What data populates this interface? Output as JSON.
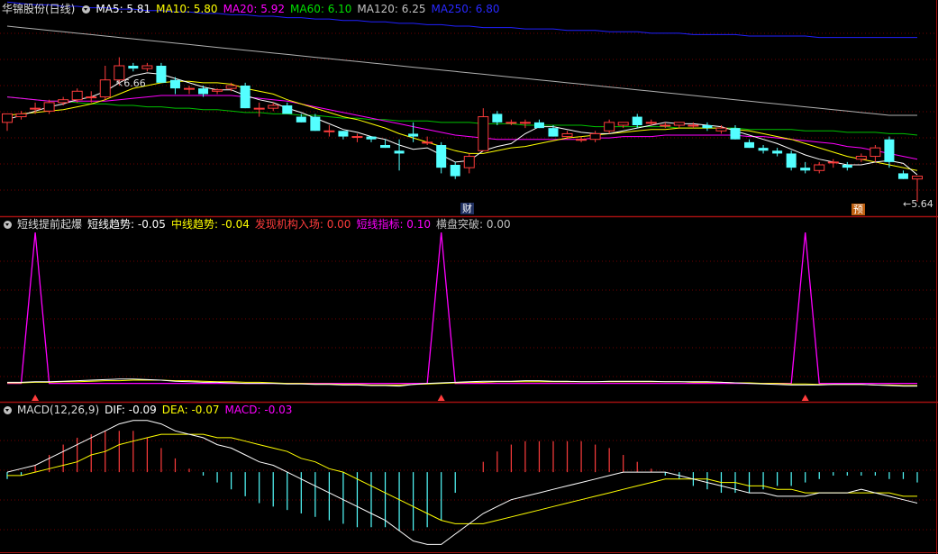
{
  "colors": {
    "up": "#ff3c3c",
    "down": "#54ffff",
    "white": "#ffffff",
    "yellow": "#ffff00",
    "magenta": "#ff00ff",
    "green": "#00c000",
    "grey": "#b0b0b0",
    "blue": "#2020ff",
    "divider": "#a01010",
    "grid": "#700000"
  },
  "panels": {
    "kline": {
      "title": "华锦股份(日线)",
      "ma": [
        {
          "name": "MA5",
          "value": "5.81",
          "color": "#ffffff"
        },
        {
          "name": "MA10",
          "value": "5.80",
          "color": "#ffff00"
        },
        {
          "name": "MA20",
          "value": "5.92",
          "color": "#ff00ff"
        },
        {
          "name": "MA60",
          "value": "6.10",
          "color": "#00e000"
        },
        {
          "name": "MA120",
          "value": "6.25",
          "color": "#c0c0c0"
        },
        {
          "name": "MA250",
          "value": "6.80",
          "color": "#2828ff"
        }
      ],
      "high_label": "6.66",
      "low_label": "5.64",
      "badge_cai": "财",
      "badge_yu": "预"
    },
    "indicator": {
      "title": "短线提前起爆",
      "items": [
        {
          "name": "短线趋势",
          "value": "-0.05",
          "color": "#ffffff"
        },
        {
          "name": "中线趋势",
          "value": "-0.04",
          "color": "#ffff00"
        },
        {
          "name": "发现机构入场",
          "value": "0.00",
          "color": "#ff3c3c"
        },
        {
          "name": "短线指标",
          "value": "0.10",
          "color": "#ff00ff"
        },
        {
          "name": "横盘突破",
          "value": "0.00",
          "color": "#c0c0c0"
        }
      ]
    },
    "macd": {
      "title": "MACD(12,26,9)",
      "items": [
        {
          "name": "DIF",
          "value": "-0.09",
          "color": "#ffffff"
        },
        {
          "name": "DEA",
          "value": "-0.07",
          "color": "#ffff00"
        },
        {
          "name": "MACD",
          "value": "-0.03",
          "color": "#ff00ff"
        }
      ]
    }
  },
  "chart_data": [
    {
      "type": "candlestick",
      "title": "华锦股份(日线)",
      "ylim": [
        5.55,
        6.95
      ],
      "candles": [
        [
          6.2,
          6.26,
          6.14,
          6.26
        ],
        [
          6.24,
          6.28,
          6.22,
          6.26
        ],
        [
          6.3,
          6.34,
          6.26,
          6.3
        ],
        [
          6.28,
          6.36,
          6.26,
          6.34
        ],
        [
          6.34,
          6.38,
          6.32,
          6.36
        ],
        [
          6.36,
          6.44,
          6.34,
          6.42
        ],
        [
          6.38,
          6.42,
          6.34,
          6.38
        ],
        [
          6.38,
          6.6,
          6.36,
          6.5
        ],
        [
          6.5,
          6.66,
          6.46,
          6.6
        ],
        [
          6.6,
          6.62,
          6.56,
          6.58
        ],
        [
          6.58,
          6.62,
          6.56,
          6.6
        ],
        [
          6.6,
          6.62,
          6.48,
          6.48
        ],
        [
          6.5,
          6.52,
          6.4,
          6.44
        ],
        [
          6.44,
          6.46,
          6.4,
          6.44
        ],
        [
          6.44,
          6.46,
          6.38,
          6.4
        ],
        [
          6.42,
          6.44,
          6.4,
          6.43
        ],
        [
          6.44,
          6.48,
          6.42,
          6.46
        ],
        [
          6.46,
          6.48,
          6.3,
          6.3
        ],
        [
          6.3,
          6.34,
          6.24,
          6.3
        ],
        [
          6.3,
          6.34,
          6.28,
          6.32
        ],
        [
          6.32,
          6.34,
          6.26,
          6.26
        ],
        [
          6.24,
          6.26,
          6.2,
          6.2
        ],
        [
          6.24,
          6.26,
          6.14,
          6.14
        ],
        [
          6.14,
          6.18,
          6.1,
          6.14
        ],
        [
          6.14,
          6.14,
          6.08,
          6.1
        ],
        [
          6.1,
          6.12,
          6.06,
          6.1
        ],
        [
          6.1,
          6.1,
          6.06,
          6.08
        ],
        [
          6.04,
          6.08,
          6.02,
          6.02
        ],
        [
          6.0,
          6.08,
          5.86,
          5.98
        ],
        [
          6.12,
          6.2,
          6.06,
          6.1
        ],
        [
          6.06,
          6.1,
          6.04,
          6.06
        ],
        [
          6.04,
          6.06,
          5.84,
          5.88
        ],
        [
          5.9,
          5.92,
          5.8,
          5.82
        ],
        [
          5.88,
          5.98,
          5.84,
          5.96
        ],
        [
          6.0,
          6.3,
          6.0,
          6.24
        ],
        [
          6.26,
          6.28,
          6.18,
          6.2
        ],
        [
          6.2,
          6.22,
          6.18,
          6.2
        ],
        [
          6.2,
          6.22,
          6.16,
          6.2
        ],
        [
          6.2,
          6.22,
          6.16,
          6.16
        ],
        [
          6.16,
          6.18,
          6.1,
          6.1
        ],
        [
          6.1,
          6.14,
          6.08,
          6.12
        ],
        [
          6.08,
          6.1,
          6.06,
          6.08
        ],
        [
          6.08,
          6.14,
          6.06,
          6.12
        ],
        [
          6.14,
          6.22,
          6.12,
          6.2
        ],
        [
          6.18,
          6.2,
          6.16,
          6.2
        ],
        [
          6.24,
          6.26,
          6.16,
          6.18
        ],
        [
          6.2,
          6.22,
          6.18,
          6.2
        ],
        [
          6.18,
          6.2,
          6.16,
          6.18
        ],
        [
          6.18,
          6.2,
          6.16,
          6.2
        ],
        [
          6.18,
          6.2,
          6.16,
          6.18
        ],
        [
          6.18,
          6.2,
          6.14,
          6.16
        ],
        [
          6.14,
          6.18,
          6.12,
          6.16
        ],
        [
          6.16,
          6.18,
          6.08,
          6.08
        ],
        [
          6.06,
          6.08,
          6.02,
          6.02
        ],
        [
          6.02,
          6.04,
          5.98,
          6.0
        ],
        [
          6.0,
          6.02,
          5.96,
          5.98
        ],
        [
          5.98,
          6.0,
          5.86,
          5.88
        ],
        [
          5.88,
          5.92,
          5.84,
          5.86
        ],
        [
          5.86,
          5.92,
          5.84,
          5.9
        ],
        [
          5.92,
          5.94,
          5.88,
          5.92
        ],
        [
          5.9,
          5.92,
          5.86,
          5.88
        ],
        [
          5.94,
          5.98,
          5.92,
          5.96
        ],
        [
          5.96,
          6.04,
          5.92,
          6.02
        ],
        [
          6.08,
          6.1,
          5.88,
          5.92
        ],
        [
          5.84,
          5.86,
          5.8,
          5.8
        ],
        [
          5.8,
          5.82,
          5.64,
          5.82
        ]
      ],
      "ma5": [
        6.22,
        6.25,
        6.28,
        6.31,
        6.33,
        6.36,
        6.38,
        6.42,
        6.48,
        6.53,
        6.55,
        6.54,
        6.51,
        6.48,
        6.45,
        6.43,
        6.43,
        6.39,
        6.36,
        6.34,
        6.3,
        6.27,
        6.23,
        6.19,
        6.15,
        6.13,
        6.1,
        6.08,
        6.04,
        6.01,
        6.02,
        5.97,
        5.92,
        5.93,
        6.0,
        6.03,
        6.05,
        6.12,
        6.17,
        6.17,
        6.15,
        6.13,
        6.12,
        6.12,
        6.14,
        6.16,
        6.18,
        6.2,
        6.19,
        6.19,
        6.18,
        6.17,
        6.14,
        6.11,
        6.08,
        6.05,
        6.01,
        5.97,
        5.94,
        5.92,
        5.9,
        5.9,
        5.92,
        5.93,
        5.91,
        5.83
      ],
      "ma10": [
        6.25,
        6.26,
        6.27,
        6.28,
        6.29,
        6.31,
        6.33,
        6.36,
        6.4,
        6.44,
        6.46,
        6.48,
        6.49,
        6.49,
        6.48,
        6.48,
        6.47,
        6.44,
        6.42,
        6.4,
        6.36,
        6.33,
        6.3,
        6.27,
        6.24,
        6.22,
        6.19,
        6.16,
        6.12,
        6.09,
        6.06,
        6.03,
        6.0,
        5.98,
        5.98,
        6.0,
        6.02,
        6.03,
        6.05,
        6.07,
        6.09,
        6.1,
        6.11,
        6.12,
        6.13,
        6.14,
        6.15,
        6.15,
        6.16,
        6.16,
        6.16,
        6.16,
        6.15,
        6.14,
        6.12,
        6.1,
        6.08,
        6.05,
        6.02,
        5.99,
        5.96,
        5.94,
        5.92,
        5.9,
        5.88,
        5.86
      ],
      "ma20": [
        6.38,
        6.37,
        6.36,
        6.35,
        6.35,
        6.35,
        6.35,
        6.35,
        6.36,
        6.37,
        6.38,
        6.39,
        6.39,
        6.39,
        6.39,
        6.39,
        6.39,
        6.38,
        6.37,
        6.36,
        6.35,
        6.33,
        6.31,
        6.29,
        6.27,
        6.25,
        6.23,
        6.21,
        6.19,
        6.17,
        6.15,
        6.13,
        6.11,
        6.1,
        6.09,
        6.08,
        6.08,
        6.08,
        6.08,
        6.08,
        6.08,
        6.08,
        6.09,
        6.09,
        6.1,
        6.1,
        6.1,
        6.11,
        6.11,
        6.11,
        6.11,
        6.11,
        6.11,
        6.1,
        6.1,
        6.09,
        6.08,
        6.07,
        6.06,
        6.05,
        6.03,
        6.02,
        6.0,
        5.98,
        5.96,
        5.94
      ],
      "ma60": [
        6.38,
        6.37,
        6.36,
        6.35,
        6.35,
        6.34,
        6.33,
        6.33,
        6.32,
        6.32,
        6.31,
        6.31,
        6.3,
        6.3,
        6.29,
        6.29,
        6.28,
        6.27,
        6.27,
        6.26,
        6.26,
        6.25,
        6.25,
        6.24,
        6.23,
        6.23,
        6.22,
        6.22,
        6.21,
        6.21,
        6.21,
        6.2,
        6.2,
        6.2,
        6.19,
        6.19,
        6.19,
        6.18,
        6.18,
        6.18,
        6.18,
        6.18,
        6.17,
        6.17,
        6.17,
        6.17,
        6.17,
        6.17,
        6.16,
        6.16,
        6.16,
        6.16,
        6.16,
        6.15,
        6.15,
        6.15,
        6.15,
        6.14,
        6.14,
        6.14,
        6.13,
        6.13,
        6.13,
        6.12,
        6.12,
        6.11
      ],
      "ma120": [
        6.88,
        6.87,
        6.86,
        6.85,
        6.84,
        6.83,
        6.82,
        6.81,
        6.8,
        6.79,
        6.78,
        6.77,
        6.76,
        6.75,
        6.74,
        6.73,
        6.72,
        6.71,
        6.7,
        6.69,
        6.68,
        6.67,
        6.66,
        6.65,
        6.64,
        6.63,
        6.62,
        6.61,
        6.6,
        6.59,
        6.58,
        6.57,
        6.56,
        6.55,
        6.54,
        6.53,
        6.52,
        6.51,
        6.5,
        6.49,
        6.48,
        6.47,
        6.46,
        6.45,
        6.44,
        6.43,
        6.42,
        6.41,
        6.4,
        6.39,
        6.38,
        6.37,
        6.36,
        6.35,
        6.34,
        6.33,
        6.32,
        6.31,
        6.3,
        6.29,
        6.28,
        6.27,
        6.26,
        6.25,
        6.25,
        6.25
      ],
      "ma250": [
        7.05,
        7.04,
        7.03,
        7.03,
        7.02,
        7.02,
        7.01,
        7.01,
        7.0,
        7.0,
        6.99,
        6.99,
        6.98,
        6.98,
        6.97,
        6.97,
        6.96,
        6.96,
        6.95,
        6.95,
        6.94,
        6.94,
        6.93,
        6.93,
        6.92,
        6.92,
        6.91,
        6.91,
        6.9,
        6.9,
        6.89,
        6.89,
        6.88,
        6.88,
        6.87,
        6.87,
        6.87,
        6.86,
        6.86,
        6.86,
        6.85,
        6.85,
        6.85,
        6.84,
        6.84,
        6.84,
        6.83,
        6.83,
        6.83,
        6.82,
        6.82,
        6.82,
        6.82,
        6.81,
        6.81,
        6.81,
        6.81,
        6.81,
        6.8,
        6.8,
        6.8,
        6.8,
        6.8,
        6.8,
        6.8,
        6.8
      ]
    },
    {
      "type": "line",
      "title": "短线提前起爆",
      "ylim": [
        -0.05,
        1.0
      ],
      "spikes_at": [
        2,
        31,
        57
      ],
      "spike_value": 1.0,
      "short_trend": [
        0.02,
        0.02,
        0.03,
        0.03,
        0.04,
        0.05,
        0.06,
        0.07,
        0.08,
        0.08,
        0.07,
        0.06,
        0.04,
        0.03,
        0.02,
        0.02,
        0.01,
        0.0,
        0.0,
        0.0,
        -0.01,
        -0.01,
        -0.02,
        -0.02,
        -0.03,
        -0.03,
        -0.04,
        -0.04,
        -0.05,
        -0.02,
        0.0,
        0.01,
        0.02,
        0.03,
        0.04,
        0.04,
        0.04,
        0.05,
        0.05,
        0.04,
        0.04,
        0.03,
        0.03,
        0.04,
        0.04,
        0.04,
        0.04,
        0.03,
        0.03,
        0.03,
        0.03,
        0.02,
        0.01,
        0.0,
        -0.01,
        -0.02,
        -0.03,
        -0.03,
        -0.03,
        -0.02,
        -0.02,
        -0.02,
        -0.03,
        -0.04,
        -0.05,
        -0.05
      ],
      "mid_trend": [
        0.01,
        0.01,
        0.02,
        0.02,
        0.03,
        0.03,
        0.04,
        0.05,
        0.05,
        0.06,
        0.06,
        0.06,
        0.05,
        0.05,
        0.04,
        0.03,
        0.03,
        0.02,
        0.02,
        0.01,
        0.0,
        0.0,
        -0.01,
        -0.01,
        -0.02,
        -0.02,
        -0.03,
        -0.03,
        -0.03,
        -0.02,
        -0.01,
        0.0,
        0.01,
        0.02,
        0.02,
        0.03,
        0.03,
        0.03,
        0.03,
        0.03,
        0.03,
        0.03,
        0.03,
        0.03,
        0.03,
        0.03,
        0.03,
        0.03,
        0.03,
        0.02,
        0.02,
        0.02,
        0.01,
        0.01,
        0.0,
        0.0,
        -0.01,
        -0.01,
        -0.02,
        -0.02,
        -0.02,
        -0.02,
        -0.03,
        -0.03,
        -0.04,
        -0.04
      ],
      "markers_at": [
        2,
        31,
        57
      ]
    },
    {
      "type": "macd",
      "title": "MACD(12,26,9)",
      "ylim": [
        -0.23,
        0.16
      ],
      "dif": [
        0.0,
        0.01,
        0.02,
        0.04,
        0.06,
        0.08,
        0.1,
        0.12,
        0.14,
        0.15,
        0.15,
        0.14,
        0.12,
        0.11,
        0.1,
        0.08,
        0.07,
        0.05,
        0.03,
        0.02,
        0.0,
        -0.02,
        -0.04,
        -0.06,
        -0.08,
        -0.1,
        -0.12,
        -0.14,
        -0.17,
        -0.2,
        -0.21,
        -0.21,
        -0.18,
        -0.15,
        -0.12,
        -0.1,
        -0.08,
        -0.07,
        -0.06,
        -0.05,
        -0.04,
        -0.03,
        -0.02,
        -0.01,
        0.0,
        0.0,
        0.0,
        0.0,
        -0.01,
        -0.02,
        -0.03,
        -0.04,
        -0.05,
        -0.06,
        -0.06,
        -0.07,
        -0.07,
        -0.07,
        -0.06,
        -0.06,
        -0.06,
        -0.05,
        -0.06,
        -0.07,
        -0.08,
        -0.09
      ],
      "dea": [
        -0.01,
        -0.01,
        0.0,
        0.01,
        0.02,
        0.03,
        0.05,
        0.06,
        0.08,
        0.09,
        0.1,
        0.11,
        0.11,
        0.11,
        0.11,
        0.1,
        0.1,
        0.09,
        0.08,
        0.07,
        0.06,
        0.04,
        0.03,
        0.01,
        0.0,
        -0.02,
        -0.04,
        -0.06,
        -0.08,
        -0.1,
        -0.12,
        -0.14,
        -0.15,
        -0.15,
        -0.15,
        -0.14,
        -0.13,
        -0.12,
        -0.11,
        -0.1,
        -0.09,
        -0.08,
        -0.07,
        -0.06,
        -0.05,
        -0.04,
        -0.03,
        -0.02,
        -0.02,
        -0.02,
        -0.02,
        -0.03,
        -0.03,
        -0.04,
        -0.04,
        -0.05,
        -0.05,
        -0.06,
        -0.06,
        -0.06,
        -0.06,
        -0.06,
        -0.06,
        -0.06,
        -0.07,
        -0.07
      ],
      "hist": [
        -0.02,
        -0.01,
        0.02,
        0.05,
        0.08,
        0.1,
        0.11,
        0.12,
        0.12,
        0.12,
        0.1,
        0.07,
        0.04,
        0.01,
        -0.01,
        -0.03,
        -0.05,
        -0.07,
        -0.09,
        -0.1,
        -0.11,
        -0.12,
        -0.13,
        -0.14,
        -0.15,
        -0.16,
        -0.16,
        -0.16,
        -0.17,
        -0.17,
        -0.16,
        -0.14,
        -0.06,
        0.0,
        0.03,
        0.06,
        0.08,
        0.09,
        0.09,
        0.09,
        0.09,
        0.09,
        0.08,
        0.07,
        0.05,
        0.03,
        0.01,
        -0.01,
        -0.02,
        -0.04,
        -0.05,
        -0.06,
        -0.06,
        -0.06,
        -0.05,
        -0.04,
        -0.04,
        -0.03,
        -0.02,
        -0.01,
        -0.01,
        -0.01,
        -0.01,
        -0.02,
        -0.02,
        -0.03
      ]
    }
  ]
}
